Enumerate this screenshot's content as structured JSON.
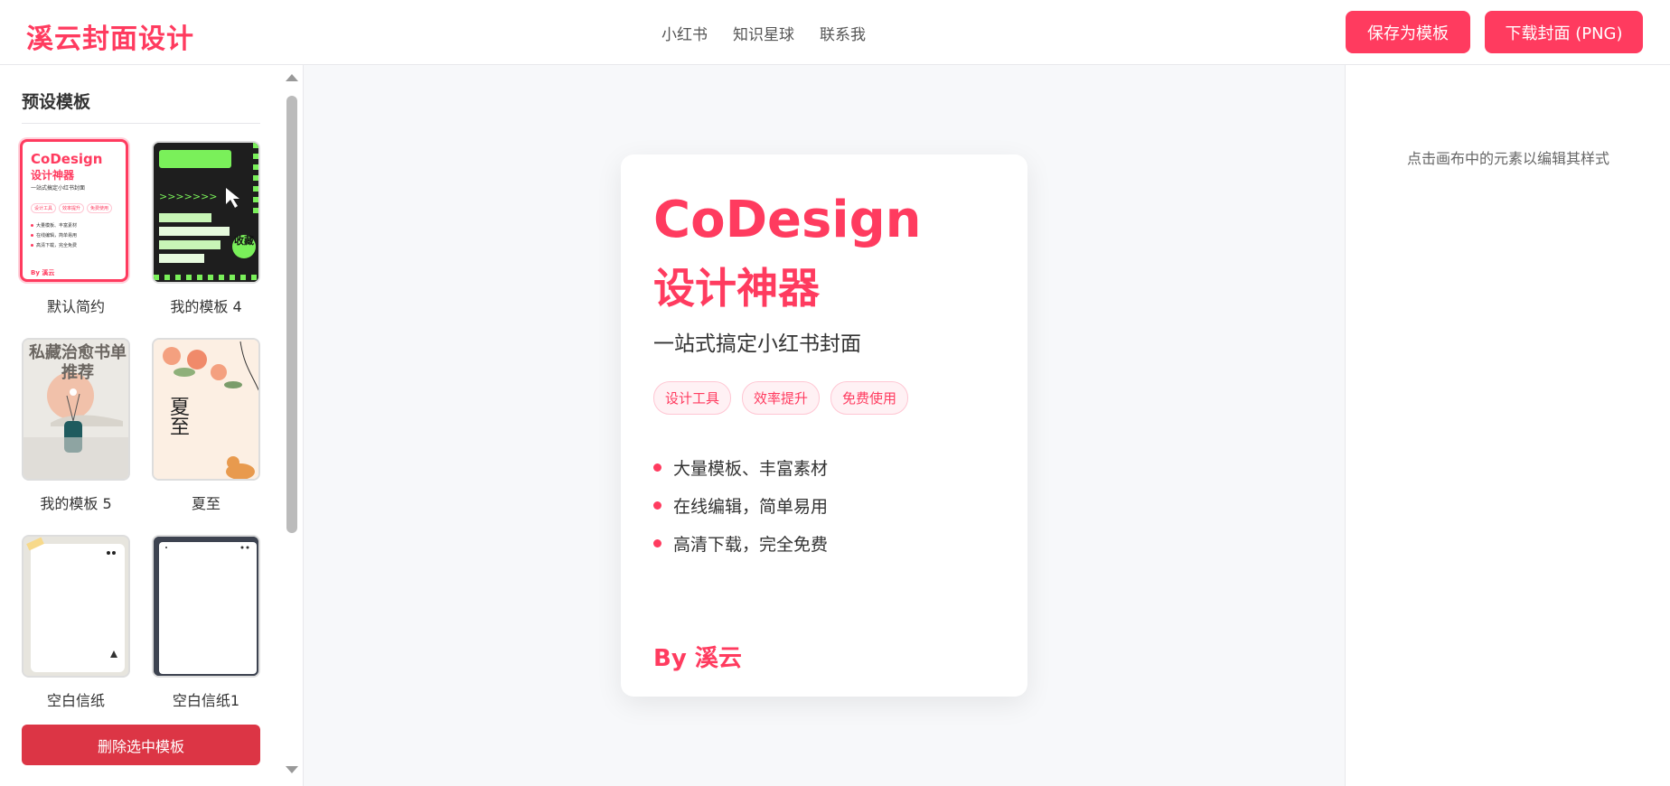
{
  "app": {
    "logo": "溪云封面设计",
    "nav": [
      "小红书",
      "知识星球",
      "联系我"
    ],
    "save_button": "保存为模板",
    "download_button": "下载封面 (PNG)",
    "brand_color": "#ff3b5f"
  },
  "sidebar": {
    "title": "预设模板",
    "templates": [
      {
        "label": "默认简约",
        "selected": true
      },
      {
        "label": "我的模板 4",
        "selected": false
      },
      {
        "label": "我的模板 5",
        "selected": false
      },
      {
        "label": "夏至",
        "selected": false
      },
      {
        "label": "空白信纸",
        "selected": false
      },
      {
        "label": "空白信纸1",
        "selected": false
      }
    ],
    "delete_button": "删除选中模板",
    "thumb1": {
      "title": "CoDesign",
      "subtitle": "设计神器",
      "tagline": "一站式搞定小红书封面",
      "tags": [
        "设计工具",
        "效率提升",
        "免费使用"
      ],
      "lines": [
        "大量模板、丰富素材",
        "在线编辑，简单易用",
        "高清下载，完全免费"
      ],
      "author": "By 溪云"
    },
    "thumb2": {
      "badge": "收藏"
    },
    "thumb3": {
      "title": "私藏治愈书单推荐"
    },
    "thumb4": {
      "title": "夏至"
    }
  },
  "canvas": {
    "title_line1": "CoDesign",
    "title_line2": "设计神器",
    "subtitle": "一站式搞定小红书封面",
    "tags": [
      "设计工具",
      "效率提升",
      "免费使用"
    ],
    "bullets": [
      "大量模板、丰富素材",
      "在线编辑，简单易用",
      "高清下载，完全免费"
    ],
    "author": "By 溪云"
  },
  "right_panel": {
    "hint": "点击画布中的元素以编辑其样式"
  }
}
